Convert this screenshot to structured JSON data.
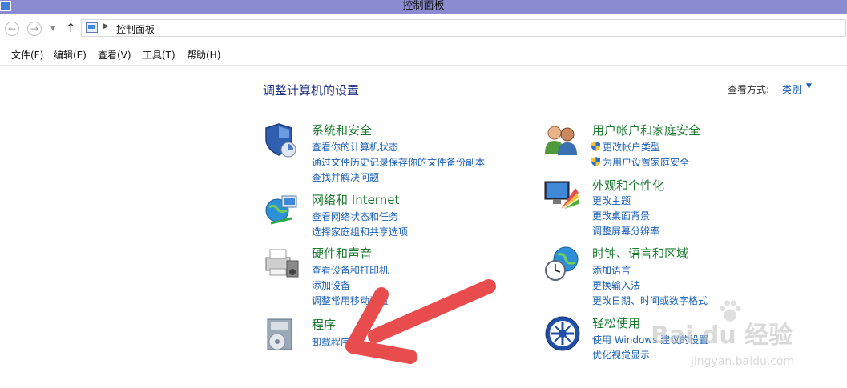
{
  "window": {
    "title": "控制面板"
  },
  "address": {
    "path_item": "控制面板"
  },
  "menu": [
    "文件(F)",
    "编辑(E)",
    "查看(V)",
    "工具(T)",
    "帮助(H)"
  ],
  "main": {
    "heading": "调整计算机的设置",
    "view_by_label": "查看方式:",
    "view_by_value": "类别"
  },
  "categories": {
    "system": {
      "title": "系统和安全",
      "links": [
        "查看你的计算机状态",
        "通过文件历史记录保存你的文件备份副本",
        "查找并解决问题"
      ]
    },
    "network": {
      "title": "网络和 Internet",
      "links": [
        "查看网络状态和任务",
        "选择家庭组和共享选项"
      ]
    },
    "hardware": {
      "title": "硬件和声音",
      "links": [
        "查看设备和打印机",
        "添加设备",
        "调整常用移动设置"
      ]
    },
    "programs": {
      "title": "程序",
      "links": [
        "卸载程序"
      ]
    },
    "users": {
      "title": "用户帐户和家庭安全",
      "links": [
        "更改帐户类型",
        "为用户设置家庭安全"
      ]
    },
    "appearance": {
      "title": "外观和个性化",
      "links": [
        "更改主题",
        "更改桌面背景",
        "调整屏幕分辨率"
      ]
    },
    "clock": {
      "title": "时钟、语言和区域",
      "links": [
        "添加语言",
        "更换输入法",
        "更改日期、时间或数字格式"
      ]
    },
    "ease": {
      "title": "轻松使用",
      "links": [
        "使用 Windows 建议的设置",
        "优化视觉显示"
      ]
    }
  },
  "watermark": {
    "brand": "Bai du 经验",
    "url": "jingyan.baidu.com"
  },
  "colors": {
    "titlebar": "#8b8bd1",
    "link": "#1a5fb4",
    "category_title": "#1b7a2f",
    "heading": "#1e3287",
    "arrow": "#e84c4c"
  }
}
